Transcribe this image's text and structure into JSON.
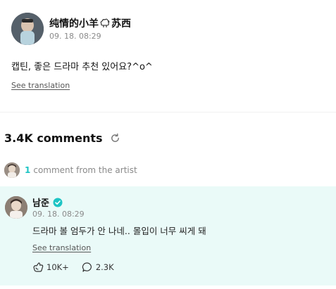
{
  "post": {
    "author_prefix": "纯情的小羊",
    "author_suffix": "苏西",
    "date": "09. 18. 08:29",
    "body": "캡틴, 좋은 드라마 추천 있어요?^o^",
    "see_translation": "See translation"
  },
  "comments": {
    "count_label": "3.4K comments",
    "artist_count": "1",
    "artist_label": "comment from the artist"
  },
  "artist_comment": {
    "name": "남준",
    "date": "09. 18. 08:29",
    "text": "드라마 볼 엄두가 안 나네.. 몰입이 너무 씨게 돼",
    "see_translation": "See translation",
    "likes": "10K+",
    "replies": "2.3K"
  },
  "colors": {
    "accent": "#1dc4c4",
    "card_background": "#eafaf8"
  },
  "icons": [
    "sheep-icon",
    "refresh-icon",
    "verified-icon",
    "like-icon",
    "reply-icon"
  ]
}
